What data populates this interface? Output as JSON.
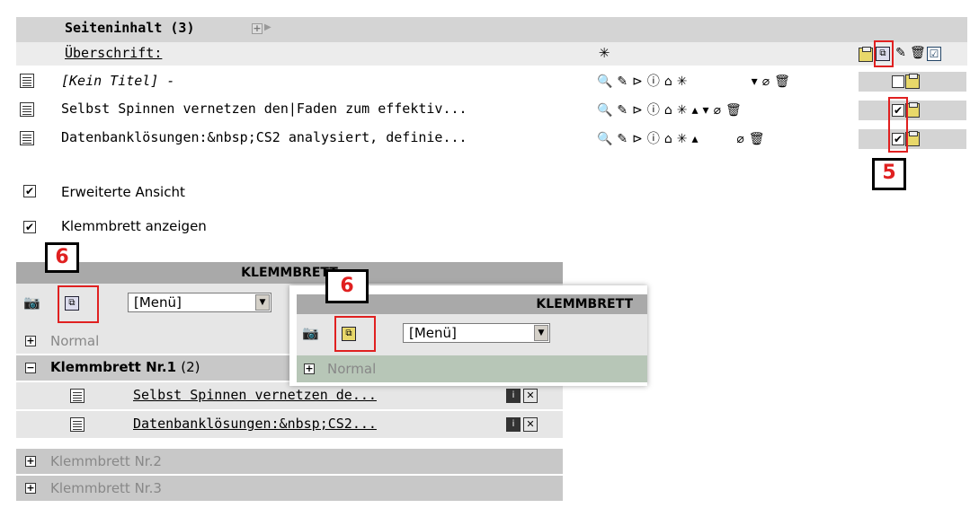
{
  "content": {
    "section_title": "Seiteninhalt (3)",
    "heading_label": "Überschrift:",
    "rows": [
      {
        "title": "[Kein Titel] -",
        "checked": false
      },
      {
        "title": "Selbst Spinnen vernetzen den|Faden zum effektiv...",
        "checked": true
      },
      {
        "title": "Datenbanklösungen:&nbsp;CS2 analysiert, definie...",
        "checked": true
      }
    ]
  },
  "options": {
    "extended_view": "Erweiterte Ansicht",
    "show_clipboard": "Klemmbrett anzeigen"
  },
  "clipboard": {
    "header": "KLEMMBRETT",
    "menu_select": "[Menü]",
    "normal": "Normal",
    "clip1_label": "Klemmbrett Nr.1",
    "clip1_count": "(2)",
    "clip1_items": [
      "Selbst Spinnen vernetzen de...",
      "Datenbanklösungen:&nbsp;CS2..."
    ],
    "clip2_label": "Klemmbrett Nr.2",
    "clip3_label": "Klemmbrett Nr.3"
  },
  "popup": {
    "header": "KLEMMBRETT",
    "menu_select": "[Menü]",
    "normal": "Normal"
  },
  "callouts": {
    "five": "5",
    "six_a": "6",
    "six_b": "6"
  },
  "colors": {
    "highlight_red": "#e02020",
    "row_grey": "#d4d4d4",
    "header_grey": "#a9a9a9",
    "popup_normal_bg": "#b7c6b7"
  }
}
